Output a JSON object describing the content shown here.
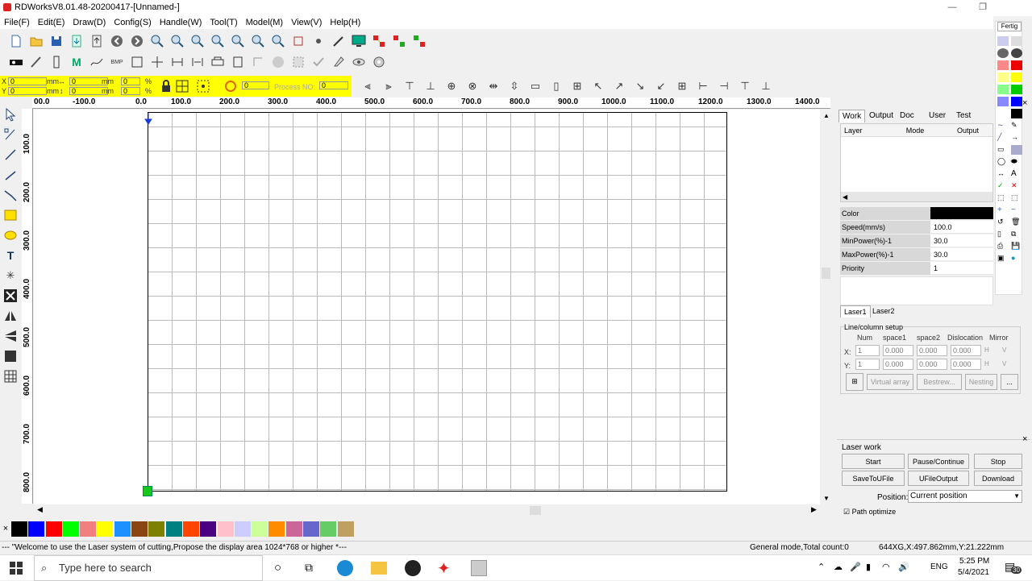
{
  "window": {
    "title": "RDWorksV8.01.48-20200417-[Unnamed-]"
  },
  "menu": [
    "File(F)",
    "Edit(E)",
    "Draw(D)",
    "Config(S)",
    "Handle(W)",
    "Tool(T)",
    "Model(M)",
    "View(V)",
    "Help(H)"
  ],
  "transform_bar": {
    "x_value": "0",
    "y_value": "0",
    "x_unit": "mm",
    "y_unit": "mm",
    "w_value": "0",
    "h_value": "0",
    "w_unit": "mm",
    "h_unit": "mm",
    "scale_x": "0",
    "scale_y": "0",
    "percent": "%",
    "rotate_value": "0",
    "process_no_label": "Process NO:",
    "process_no_value": "0"
  },
  "ruler_top": [
    "00.0",
    "-100.0",
    "0.0",
    "100.0",
    "200.0",
    "300.0",
    "400.0",
    "500.0",
    "600.0",
    "700.0",
    "800.0",
    "900.0",
    "1000.0",
    "1100.0",
    "1200.0",
    "1300.0",
    "1400.0"
  ],
  "ruler_left": [
    "100.0",
    "200.0",
    "300.0",
    "400.0",
    "500.0",
    "600.0",
    "700.0",
    "800.0"
  ],
  "palette": [
    "#000000",
    "#0000ff",
    "#ff0000",
    "#00ff00",
    "#f08080",
    "#ffff00",
    "#1e90ff",
    "#8b4513",
    "#808000",
    "#008080",
    "#ff4500",
    "#4b0082",
    "#ffc0cb",
    "#ccccff",
    "#ccff99",
    "#ff8c00",
    "#cc6699",
    "#6666cc",
    "#66cc66",
    "#c0a060"
  ],
  "right_panel": {
    "tabs": [
      "Work",
      "Output",
      "Doc",
      "User",
      "Test"
    ],
    "layer_headers": [
      "Layer",
      "Mode",
      "Output"
    ],
    "props": [
      {
        "k": "Color",
        "v": ""
      },
      {
        "k": "Speed(mm/s)",
        "v": "100.0"
      },
      {
        "k": "MinPower(%)-1",
        "v": "30.0"
      },
      {
        "k": "MaxPower(%)-1",
        "v": "30.0"
      },
      {
        "k": "Priority",
        "v": "1"
      }
    ],
    "laser_tabs": [
      "Laser1",
      "Laser2"
    ],
    "line_column": {
      "title": "Line/column setup",
      "headers": [
        "Num",
        "space1",
        "space2",
        "Dislocation",
        "Mirror"
      ],
      "x_label": "X:",
      "y_label": "Y:",
      "x_num": "1",
      "y_num": "1",
      "zero": "0.000",
      "h": "H",
      "v": "V"
    },
    "buttons_array": [
      "Virtual array",
      "Bestrew...",
      "Nesting",
      "..."
    ],
    "laser_work": {
      "title": "Laser work",
      "start": "Start",
      "pause": "Pause/Continue",
      "stop": "Stop",
      "save_u": "SaveToUFile",
      "ufile_out": "UFileOutput",
      "download": "Download",
      "position_label": "Position:",
      "position_value": "Current position",
      "path_optimize": "Path optimize"
    }
  },
  "far_right": {
    "label": "Fertig"
  },
  "status": {
    "message": "--- \"Welcome to use the Laser system of cutting,Propose the display area 1024*768 or higher *---",
    "mode": "General mode,Total count:0",
    "coords": "644XG,X:497.862mm,Y:21.222mm"
  },
  "taskbar": {
    "search_placeholder": "Type here to search",
    "lang": "ENG",
    "time": "5:25 PM",
    "date": "5/4/2021",
    "notif_count": "30"
  }
}
